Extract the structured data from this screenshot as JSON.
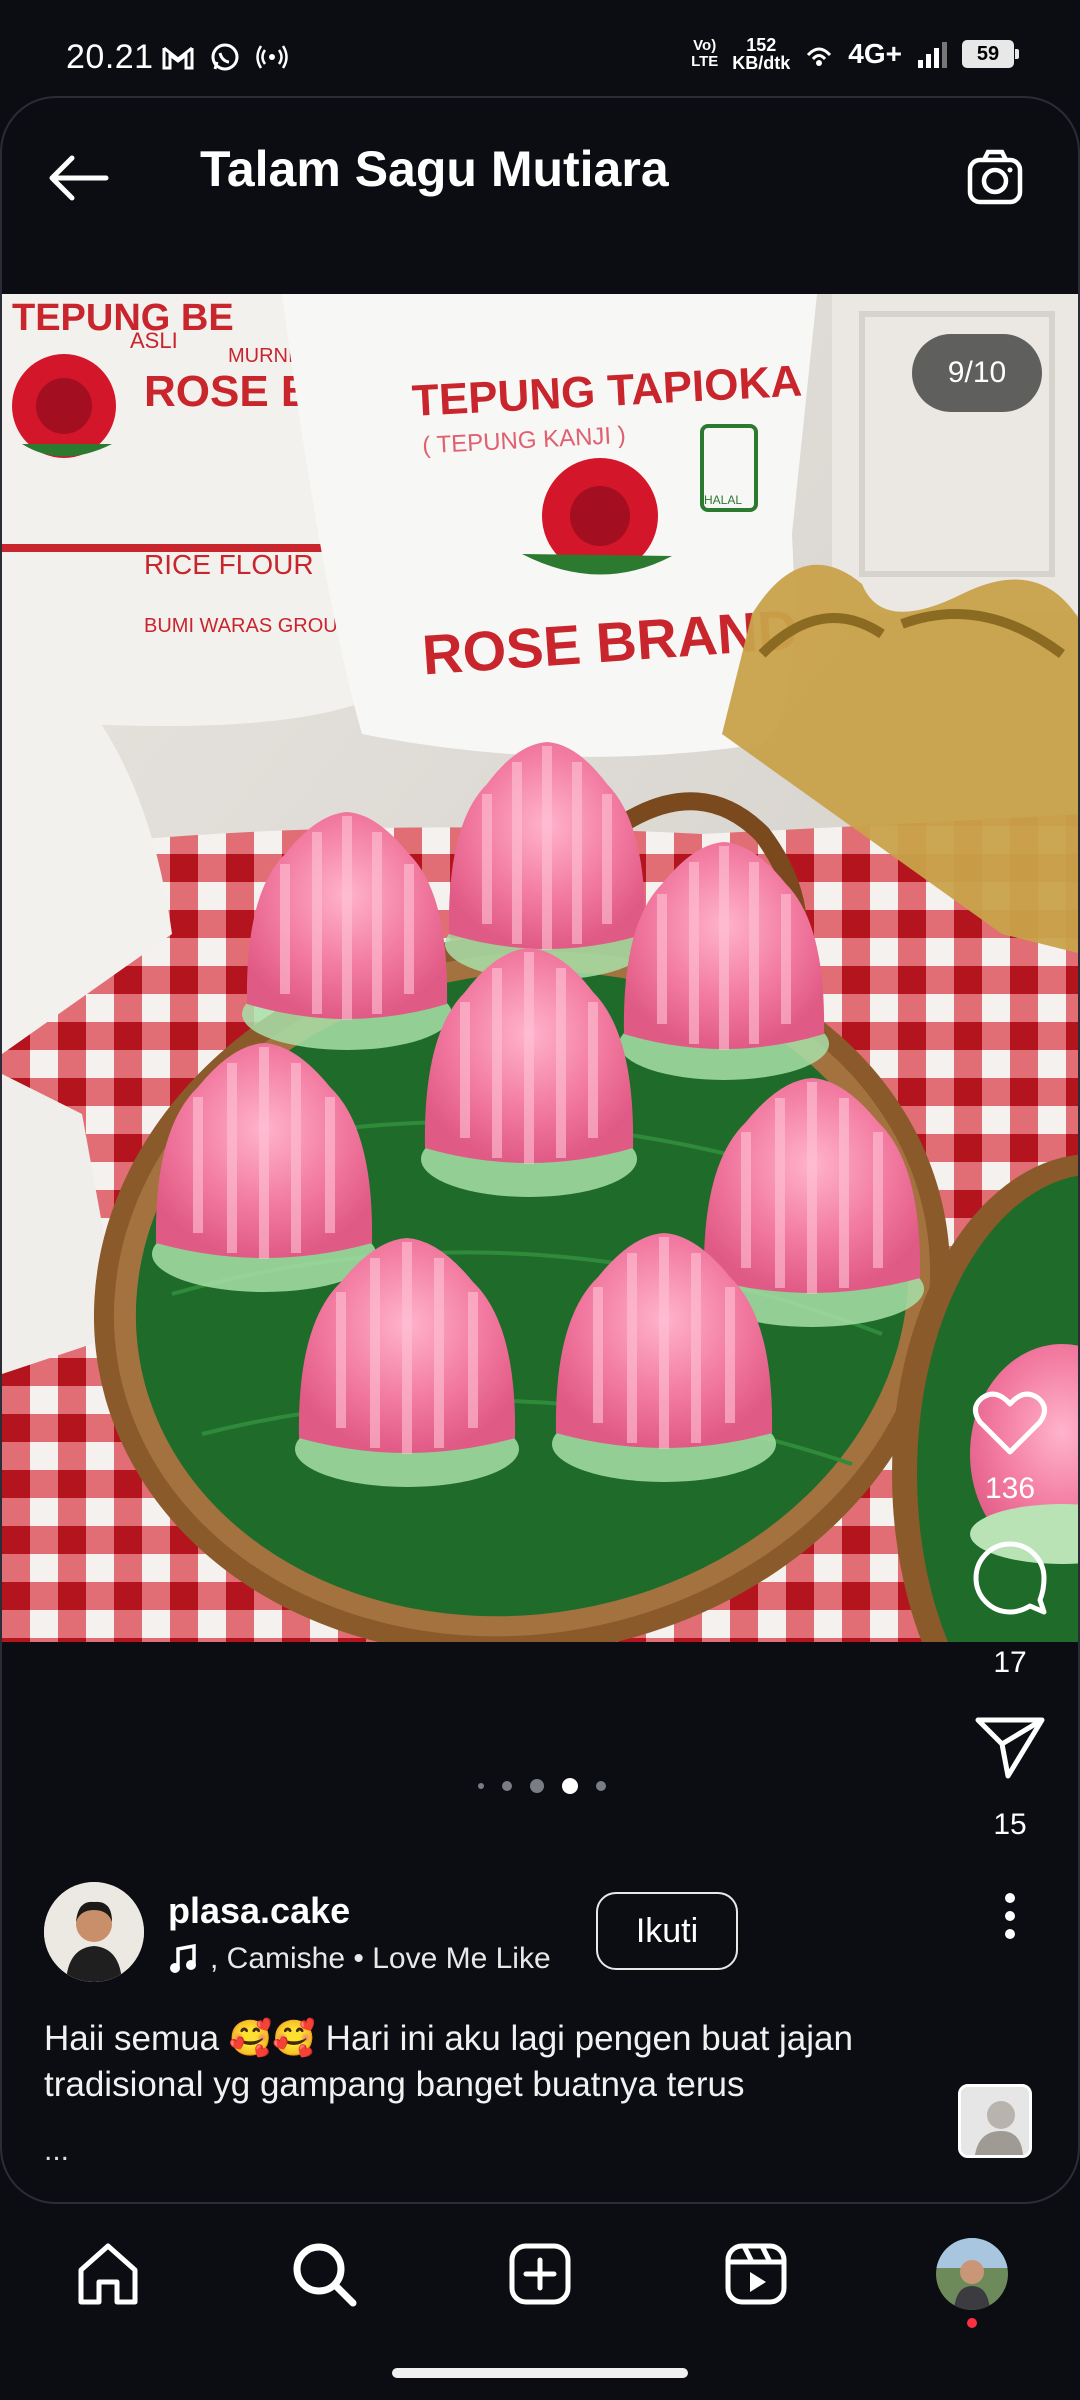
{
  "status_bar": {
    "time": "20.21",
    "net_speed_value": "152",
    "net_speed_unit": "KB/dtk",
    "volte_label": "VoLTE",
    "network": "4G+",
    "battery": "59"
  },
  "header": {
    "title": "Talam Sagu Mutiara"
  },
  "post": {
    "counter": "9/10",
    "like_count": "136",
    "comment_count": "17",
    "share_count": "15",
    "username": "plasa.cake",
    "music": ", Camishe • Love Me Like",
    "follow_label": "Ikuti",
    "caption": "Haii semua 🥰🥰 Hari ini aku lagi pengen buat jajan tradisional yg gampang banget buatnya terus",
    "caption_more": "...",
    "photo_labels": {
      "bag_left_murni": "MURNI",
      "bag_left_rose": "ROSE BRA",
      "bag_left_rice": "RICE FLOUR",
      "bag_left_group": "BUMI WARAS GROUP",
      "bag_left_asli": "ASLI",
      "bag_main_title": "TEPUNG TAPIOKA",
      "bag_main_sub": "( TEPUNG KANJI )",
      "bag_main_brand": "ROSE BRAND",
      "halal": "HALAL"
    },
    "pagination": {
      "dot_count": 5,
      "active_index": 3
    }
  },
  "colors": {
    "background": "#0b0d12",
    "cake_pink": "#f27aa0",
    "leaf_green": "#1f6b2a",
    "cloth_red": "#c8252c",
    "notification_red": "#ff3040"
  },
  "icons": {
    "back": "arrow-left-icon",
    "camera": "camera-icon",
    "like": "heart-icon",
    "comment": "comment-icon",
    "share": "send-icon",
    "more": "more-vertical-icon",
    "home": "home-icon",
    "search": "search-icon",
    "create": "plus-square-icon",
    "reels": "reels-icon"
  }
}
